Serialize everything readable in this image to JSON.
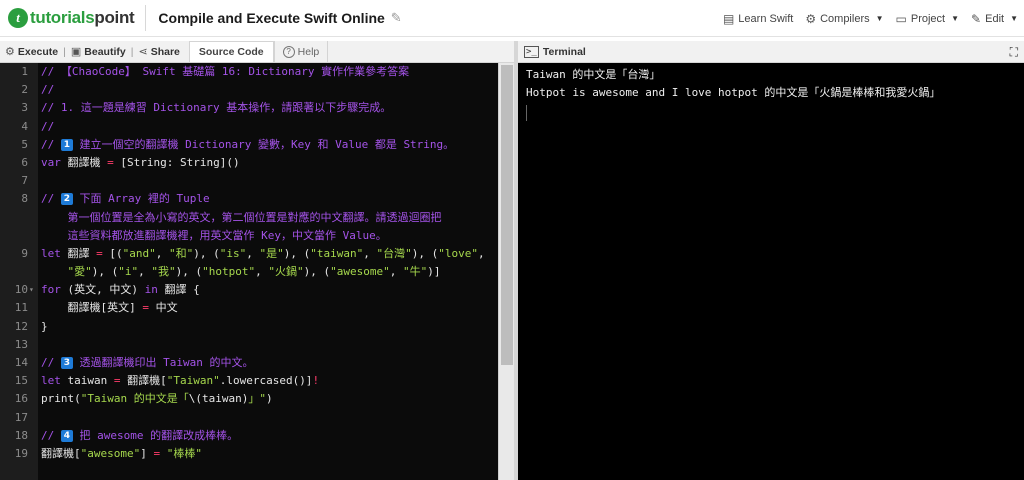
{
  "header": {
    "logo_text_a": "tutorials",
    "logo_text_b": "point",
    "page_title": "Compile and Execute Swift Online",
    "nav": {
      "learn": "Learn Swift",
      "compilers": "Compilers",
      "project": "Project",
      "edit": "Edit"
    }
  },
  "toolbar": {
    "execute": "Execute",
    "beautify": "Beautify",
    "share": "Share",
    "source_code": "Source Code",
    "help": "Help"
  },
  "terminal": {
    "title": "Terminal",
    "output": [
      "Taiwan 的中文是「台灣」",
      "Hotpot is awesome and I love hotpot 的中文是「火鍋是棒棒和我愛火鍋」"
    ]
  },
  "code_lines": [
    {
      "n": "1",
      "fold": "",
      "tokens": [
        [
          "c",
          "// 【ChaoCode】 Swift 基礎篇 16: Dictionary 實作作業參考答案"
        ]
      ]
    },
    {
      "n": "2",
      "fold": "",
      "tokens": [
        [
          "c",
          "//"
        ]
      ]
    },
    {
      "n": "3",
      "fold": "",
      "tokens": [
        [
          "c",
          "// 1. 這一題是練習 Dictionary 基本操作，請跟著以下步驟完成。"
        ]
      ]
    },
    {
      "n": "4",
      "fold": "",
      "tokens": [
        [
          "c",
          "//"
        ]
      ]
    },
    {
      "n": "5",
      "fold": "",
      "tokens": [
        [
          "c",
          "// "
        ],
        [
          "b",
          "1"
        ],
        [
          "c",
          " 建立一個空的翻譯機 Dictionary 變數，Key 和 Value 都是 String。"
        ]
      ]
    },
    {
      "n": "6",
      "fold": "",
      "tokens": [
        [
          "k",
          "var"
        ],
        [
          "p",
          " 翻譯機 "
        ],
        [
          "op",
          "="
        ],
        [
          "p",
          " [String: String]()"
        ]
      ]
    },
    {
      "n": "7",
      "fold": "",
      "tokens": []
    },
    {
      "n": "8",
      "fold": "",
      "tokens": [
        [
          "c",
          "// "
        ],
        [
          "b",
          "2"
        ],
        [
          "c",
          " 下面 Array 裡的 Tuple"
        ]
      ]
    },
    {
      "n": "",
      "fold": "",
      "tokens": [
        [
          "c",
          "    第一個位置是全為小寫的英文，第二個位置是對應的中文翻譯。請透過迴圈把"
        ]
      ]
    },
    {
      "n": "",
      "fold": "",
      "tokens": [
        [
          "c",
          "    這些資料都放進翻譯機裡，用英文當作 Key，中文當作 Value。"
        ]
      ]
    },
    {
      "n": "9",
      "fold": "",
      "tokens": [
        [
          "k",
          "let"
        ],
        [
          "p",
          " 翻譯 "
        ],
        [
          "op",
          "="
        ],
        [
          "p",
          " [("
        ],
        [
          "s",
          "\"and\""
        ],
        [
          "p",
          ", "
        ],
        [
          "s",
          "\"和\""
        ],
        [
          "p",
          "), ("
        ],
        [
          "s",
          "\"is\""
        ],
        [
          "p",
          ", "
        ],
        [
          "s",
          "\"是\""
        ],
        [
          "p",
          "), ("
        ],
        [
          "s",
          "\"taiwan\""
        ],
        [
          "p",
          ", "
        ],
        [
          "s",
          "\"台灣\""
        ],
        [
          "p",
          "), ("
        ],
        [
          "s",
          "\"love\""
        ],
        [
          "p",
          ","
        ]
      ]
    },
    {
      "n": "",
      "fold": "",
      "tokens": [
        [
          "p",
          "    "
        ],
        [
          "s",
          "\"愛\""
        ],
        [
          "p",
          "), ("
        ],
        [
          "s",
          "\"i\""
        ],
        [
          "p",
          ", "
        ],
        [
          "s",
          "\"我\""
        ],
        [
          "p",
          "), ("
        ],
        [
          "s",
          "\"hotpot\""
        ],
        [
          "p",
          ", "
        ],
        [
          "s",
          "\"火鍋\""
        ],
        [
          "p",
          "), ("
        ],
        [
          "s",
          "\"awesome\""
        ],
        [
          "p",
          ", "
        ],
        [
          "s",
          "\"牛\""
        ],
        [
          "p",
          ")]"
        ]
      ]
    },
    {
      "n": "10",
      "fold": "▾",
      "tokens": [
        [
          "k",
          "for"
        ],
        [
          "p",
          " (英文, 中文) "
        ],
        [
          "k",
          "in"
        ],
        [
          "p",
          " 翻譯 {"
        ]
      ]
    },
    {
      "n": "11",
      "fold": "",
      "tokens": [
        [
          "p",
          "    翻譯機[英文] "
        ],
        [
          "op",
          "="
        ],
        [
          "p",
          " 中文"
        ]
      ]
    },
    {
      "n": "12",
      "fold": "",
      "tokens": [
        [
          "p",
          "}"
        ]
      ]
    },
    {
      "n": "13",
      "fold": "",
      "tokens": []
    },
    {
      "n": "14",
      "fold": "",
      "tokens": [
        [
          "c",
          "// "
        ],
        [
          "b",
          "3"
        ],
        [
          "c",
          " 透過翻譯機印出 Taiwan 的中文。"
        ]
      ]
    },
    {
      "n": "15",
      "fold": "",
      "tokens": [
        [
          "k",
          "let"
        ],
        [
          "p",
          " taiwan "
        ],
        [
          "op",
          "="
        ],
        [
          "p",
          " 翻譯機["
        ],
        [
          "s",
          "\"Taiwan\""
        ],
        [
          "p",
          ".lowercased()]"
        ],
        [
          "op",
          "!"
        ]
      ]
    },
    {
      "n": "16",
      "fold": "",
      "tokens": [
        [
          "p",
          "print("
        ],
        [
          "s",
          "\"Taiwan 的中文是「"
        ],
        [
          "p",
          "\\(taiwan)"
        ],
        [
          "s",
          "」\""
        ],
        [
          "p",
          ")"
        ]
      ]
    },
    {
      "n": "17",
      "fold": "",
      "tokens": []
    },
    {
      "n": "18",
      "fold": "",
      "tokens": [
        [
          "c",
          "// "
        ],
        [
          "b",
          "4"
        ],
        [
          "c",
          " 把 awesome 的翻譯改成棒棒。"
        ]
      ]
    },
    {
      "n": "19",
      "fold": "",
      "tokens": [
        [
          "p",
          "翻譯機["
        ],
        [
          "s",
          "\"awesome\""
        ],
        [
          "p",
          "] "
        ],
        [
          "op",
          "="
        ],
        [
          "p",
          " "
        ],
        [
          "s",
          "\"棒棒\""
        ]
      ]
    }
  ]
}
